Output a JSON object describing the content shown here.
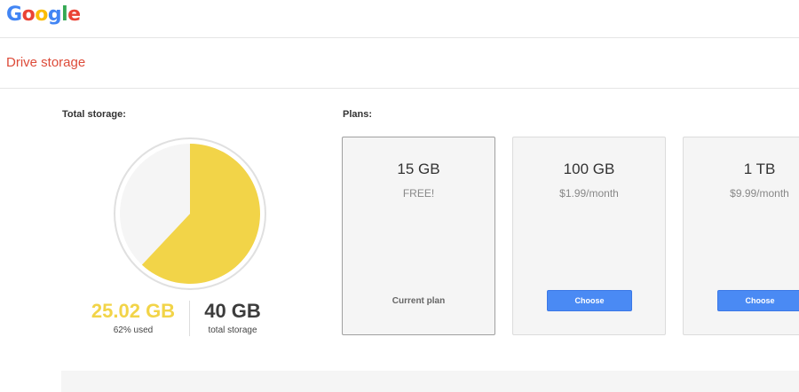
{
  "header": {
    "logo_letters": [
      {
        "ch": "G",
        "color": "#4285f4"
      },
      {
        "ch": "o",
        "color": "#ea4335"
      },
      {
        "ch": "o",
        "color": "#fbbc05"
      },
      {
        "ch": "g",
        "color": "#4285f4"
      },
      {
        "ch": "l",
        "color": "#34a853"
      },
      {
        "ch": "e",
        "color": "#ea4335"
      }
    ]
  },
  "section": {
    "title": "Drive storage"
  },
  "storage": {
    "label": "Total storage:",
    "used_value": "25.02 GB",
    "used_caption": "62% used",
    "used_fraction": 0.62,
    "total_value": "40 GB",
    "total_caption": "total storage",
    "used_color": "#f2d448",
    "free_color": "#f5f5f5"
  },
  "plans_label": "Plans:",
  "plans": [
    {
      "size": "15 GB",
      "price": "FREE!",
      "status": "Current plan"
    },
    {
      "size": "100 GB",
      "price": "$1.99/month",
      "button": "Choose"
    },
    {
      "size": "1 TB",
      "price": "$9.99/month",
      "button": "Choose"
    }
  ],
  "accent_color": "#4a8af4",
  "section_color": "#dd4b39"
}
